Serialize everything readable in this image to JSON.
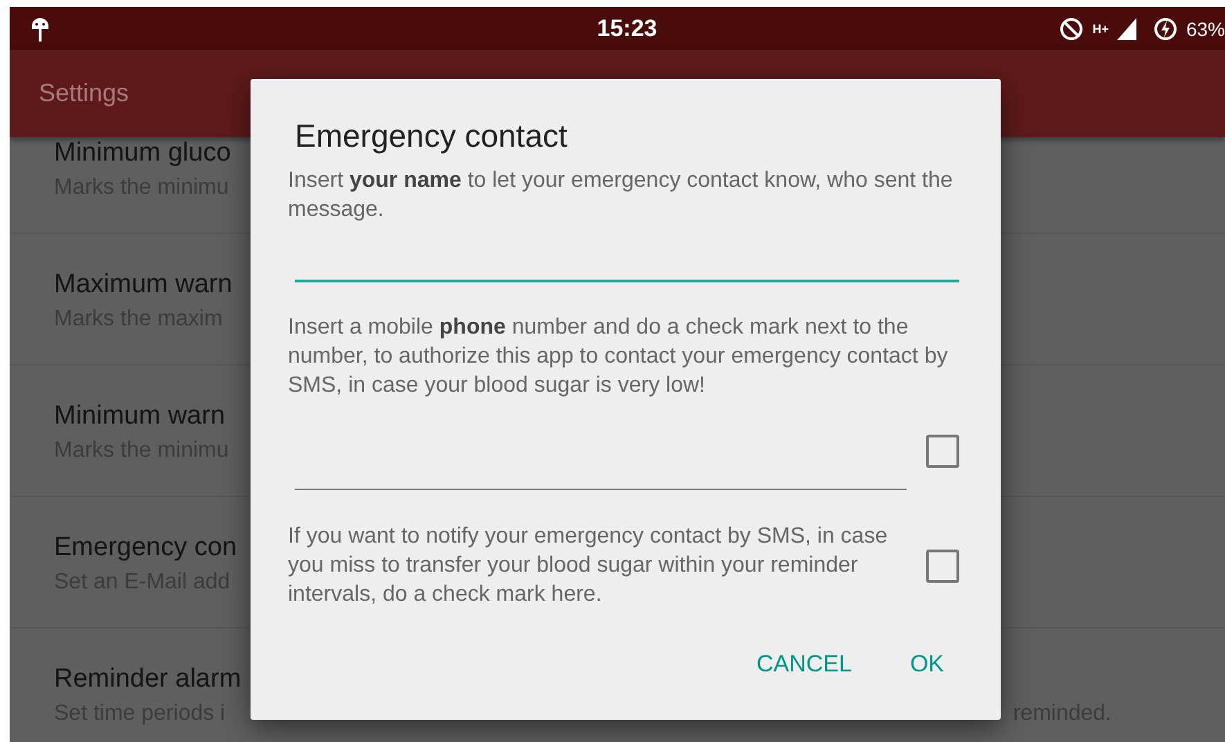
{
  "status_bar": {
    "time": "15:23",
    "network": "H+",
    "battery": "63%"
  },
  "app_bar": {
    "title": "Settings"
  },
  "settings": [
    {
      "title": "Minimum gluco",
      "subtitle": "Marks the minimu"
    },
    {
      "title": "Maximum warn",
      "subtitle": "Marks the maxim"
    },
    {
      "title": "Minimum warn",
      "subtitle": "Marks the minimu"
    },
    {
      "title": "Emergency con",
      "subtitle": "Set an E-Mail add"
    },
    {
      "title": "Reminder alarm",
      "subtitle": "Set time periods i",
      "subtitle_end": "reminded."
    }
  ],
  "dialog": {
    "title": "Emergency contact",
    "name_prompt": "Insert **your name** to let your emergency contact know, who sent the message.",
    "name_field": {
      "focused": true
    },
    "phone_prompt": "Insert a mobile **phone** number and do a check mark next to the number, to authorize this app to contact your emergency contact by SMS, in case your blood sugar is very low!",
    "phone_field": {
      "focused": false
    },
    "phone_checkbox": {
      "checked": false
    },
    "sms_prompt": "If you want to notify your emergency contact by SMS, in case you miss to transfer your blood sugar within your reminder intervals, do a check mark here.",
    "sms_checkbox": {
      "checked": false
    },
    "buttons": [
      "CANCEL",
      "OK"
    ]
  }
}
